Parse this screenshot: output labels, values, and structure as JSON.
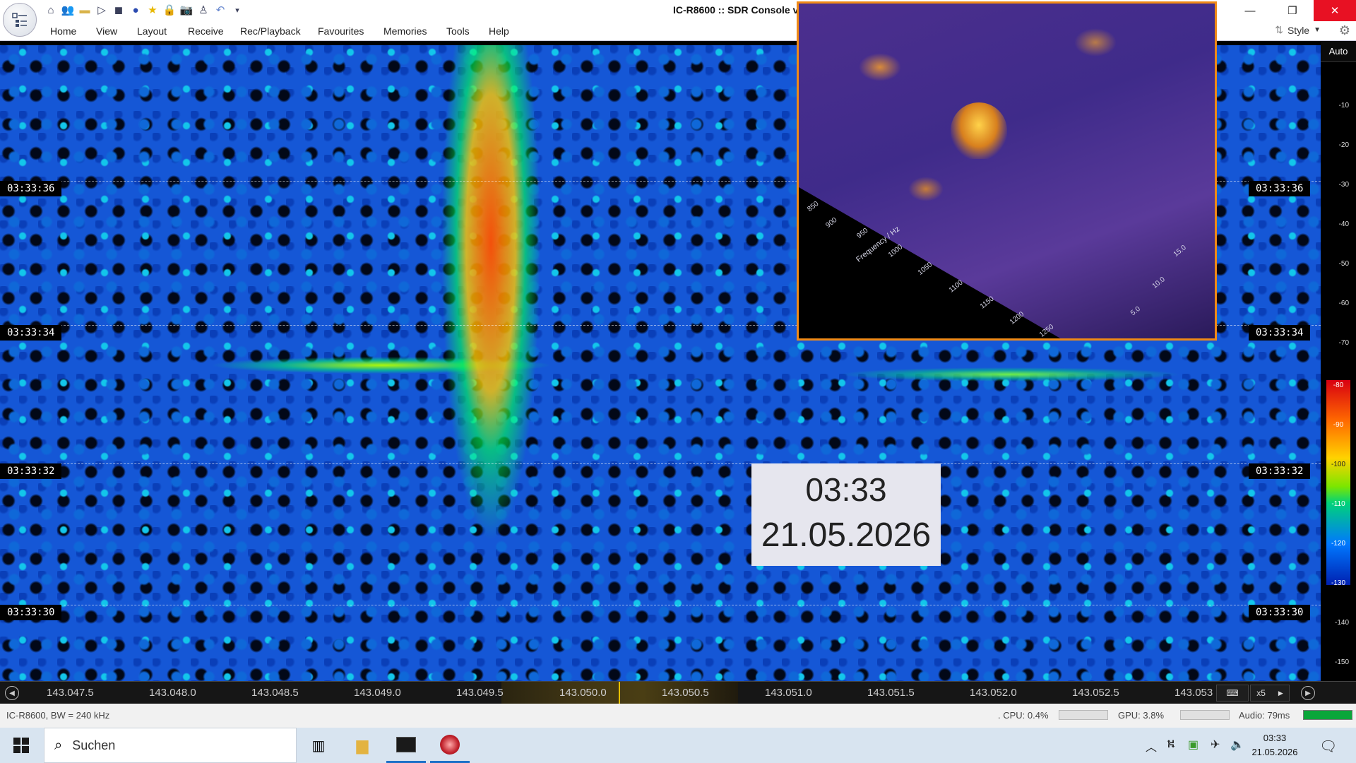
{
  "window": {
    "title": "IC-R8600 :: SDR Console v3",
    "controls": {
      "minimize": "—",
      "restore": "❐",
      "close": "✕"
    }
  },
  "quick_access": [
    "home-icon",
    "users-icon",
    "folder-icon",
    "play-icon",
    "stop-icon",
    "record-icon",
    "favourite-star-icon",
    "lock-icon",
    "snapshot-camera-icon",
    "satellite-icon",
    "undo-icon",
    "dropdown-icon"
  ],
  "menu": {
    "items": [
      "Home",
      "View",
      "Layout",
      "Receive",
      "Rec/Playback",
      "Favourites",
      "Memories",
      "Tools",
      "Help"
    ],
    "style_label": "Style"
  },
  "waterfall": {
    "time_labels": [
      "03:33:36",
      "03:33:34",
      "03:33:32",
      "03:33:30"
    ],
    "signal_colors": {
      "hot": "#ff3a00",
      "warm": "#ffd200",
      "band": "#8cff00",
      "background": "#1557d6"
    }
  },
  "inset_3d": {
    "freq_axis_title": "Frequency / Hz",
    "freq_ticks": [
      "850",
      "900",
      "950",
      "1000",
      "1050",
      "1100",
      "1150",
      "1200",
      "1250"
    ],
    "time_ticks": [
      "5.0",
      "10.0",
      "15.0"
    ]
  },
  "datebox": {
    "time": "03:33",
    "date": "21.05.2026"
  },
  "db_scale": {
    "auto_label": "Auto",
    "marks": [
      "-10",
      "-20",
      "-30",
      "-40",
      "-50",
      "-60",
      "-70",
      "-80",
      "-90",
      "-100",
      "-110",
      "-120",
      "-130",
      "-140",
      "-150"
    ]
  },
  "freq_axis": {
    "labels": [
      "143.047.5",
      "143.048.0",
      "143.048.5",
      "143.049.0",
      "143.049.5",
      "143.050.0",
      "143.050.5",
      "143.051.0",
      "143.051.5",
      "143.052.0",
      "143.052.5",
      "143.053"
    ],
    "zoom_label": "x5"
  },
  "status": {
    "device": "IC-R8600, BW = 240 kHz",
    "cpu": ". CPU: 0.4%",
    "gpu": "GPU: 3.8%",
    "audio": "Audio: 79ms"
  },
  "taskbar": {
    "search_placeholder": "Suchen",
    "time": "03:33",
    "date": "21.05.2026"
  }
}
